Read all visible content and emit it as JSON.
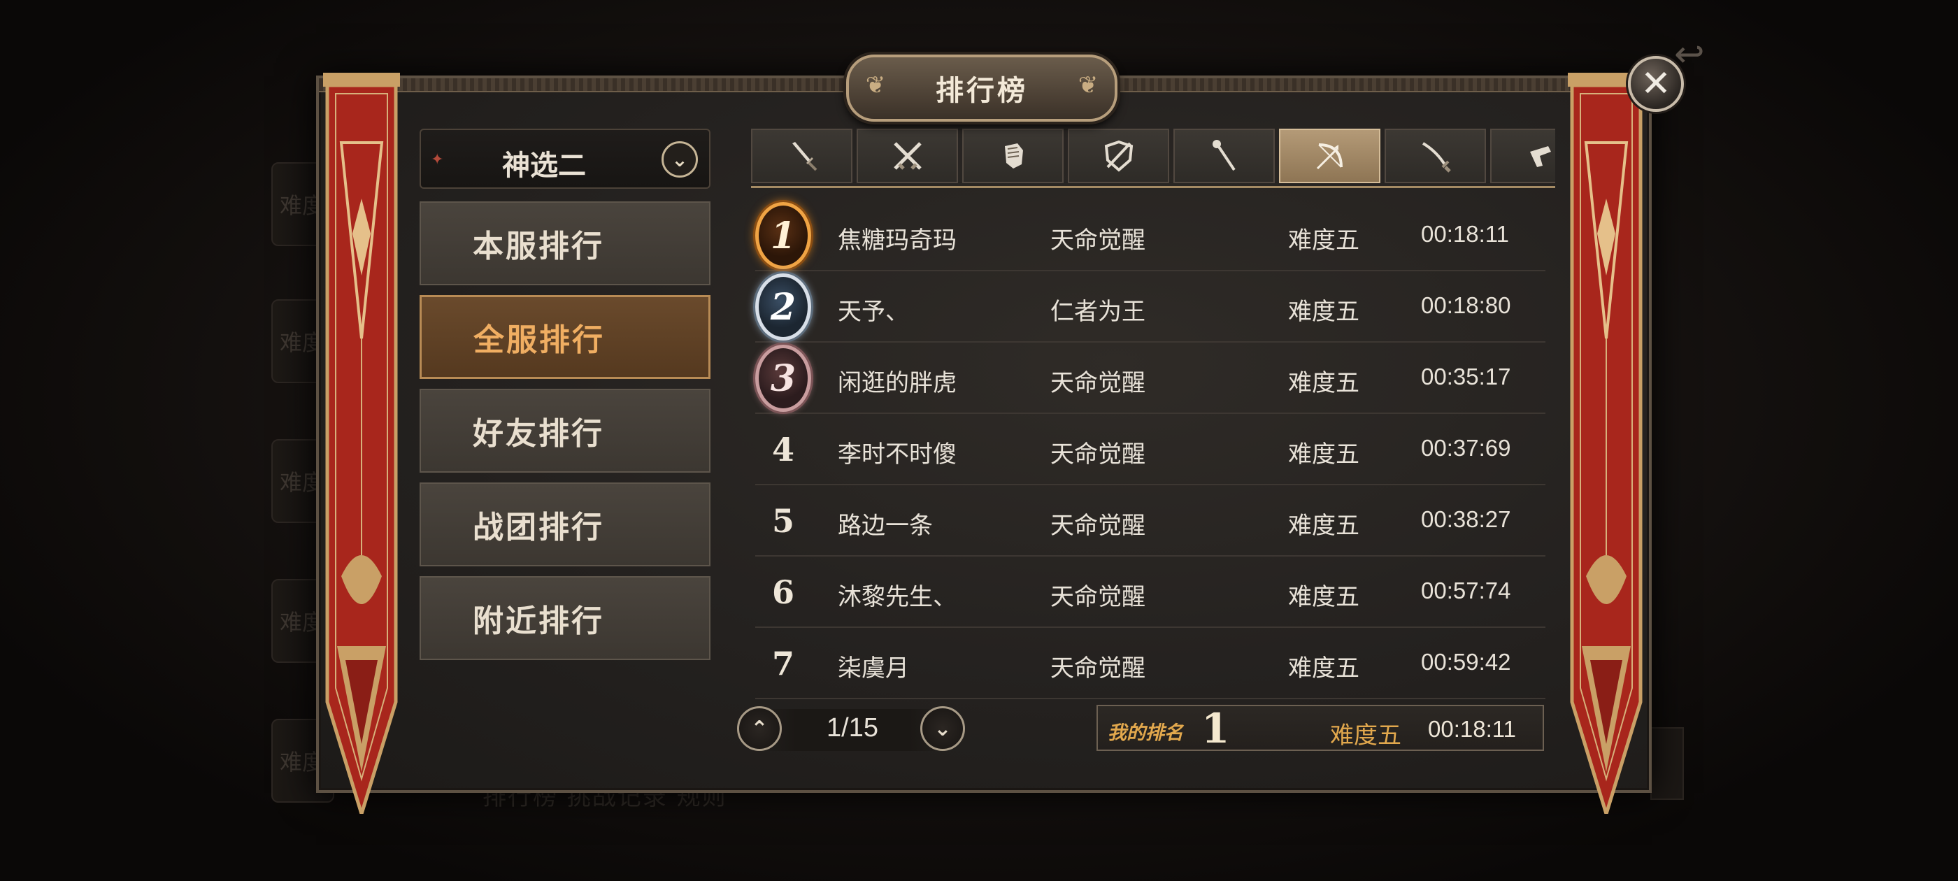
{
  "title": "排行榜",
  "server": {
    "selected": "神选二"
  },
  "nav": [
    {
      "label": "本服排行",
      "active": false
    },
    {
      "label": "全服排行",
      "active": true
    },
    {
      "label": "好友排行",
      "active": false
    },
    {
      "label": "战团排行",
      "active": false
    },
    {
      "label": "附近排行",
      "active": false
    }
  ],
  "weapon_tabs": [
    {
      "icon": "dagger-icon",
      "active": false
    },
    {
      "icon": "crossed-swords-icon",
      "active": false
    },
    {
      "icon": "gauntlet-icon",
      "active": false
    },
    {
      "icon": "shield-icon",
      "active": false
    },
    {
      "icon": "staff-icon",
      "active": false
    },
    {
      "icon": "bow-icon",
      "active": true
    },
    {
      "icon": "katana-icon",
      "active": false
    },
    {
      "icon": "gun-icon",
      "active": false
    }
  ],
  "rankings": [
    {
      "rank": "1",
      "name": "焦糖玛奇玛",
      "title": "天命觉醒",
      "difficulty": "难度五",
      "time": "00:18:11"
    },
    {
      "rank": "2",
      "name": "天予、",
      "title": "仁者为王",
      "difficulty": "难度五",
      "time": "00:18:80"
    },
    {
      "rank": "3",
      "name": "闲逛的胖虎",
      "title": "天命觉醒",
      "difficulty": "难度五",
      "time": "00:35:17"
    },
    {
      "rank": "4",
      "name": "李时不时傻",
      "title": "天命觉醒",
      "difficulty": "难度五",
      "time": "00:37:69"
    },
    {
      "rank": "5",
      "name": "路边一条",
      "title": "天命觉醒",
      "difficulty": "难度五",
      "time": "00:38:27"
    },
    {
      "rank": "6",
      "name": "沐黎先生、",
      "title": "天命觉醒",
      "difficulty": "难度五",
      "time": "00:57:74"
    },
    {
      "rank": "7",
      "name": "柒虞月",
      "title": "天命觉醒",
      "difficulty": "难度五",
      "time": "00:59:42"
    }
  ],
  "pager": {
    "label": "1/15"
  },
  "my_rank": {
    "label": "我的排名",
    "rank": "1",
    "difficulty": "难度五",
    "time": "00:18:11"
  },
  "background": {
    "tab_label": "难度",
    "footer_text": "排行榜  挑战记录  规则"
  },
  "colors": {
    "active_nav": "#f0ae62",
    "gold_label": "#e2a84d",
    "banner_red": "#a8261c",
    "banner_gold": "#c9a066"
  }
}
